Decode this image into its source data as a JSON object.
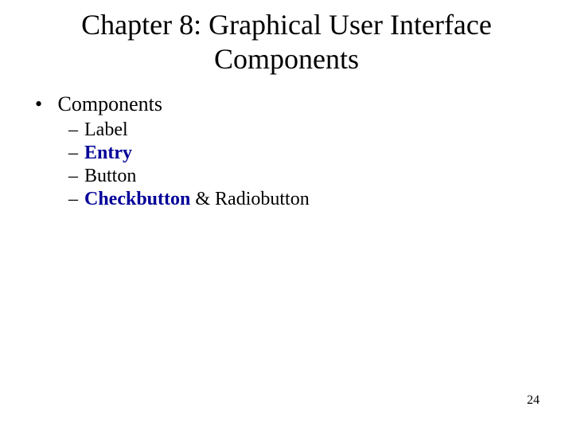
{
  "title": "Chapter 8: Graphical User Interface Components",
  "bullet": {
    "label": "Components",
    "items": {
      "label_text": "Label",
      "entry_text": "Entry",
      "button_text": "Button",
      "checkbutton_label": "Checkbutton",
      "checkbutton_tail": " & Radiobutton"
    }
  },
  "page_number": "24"
}
